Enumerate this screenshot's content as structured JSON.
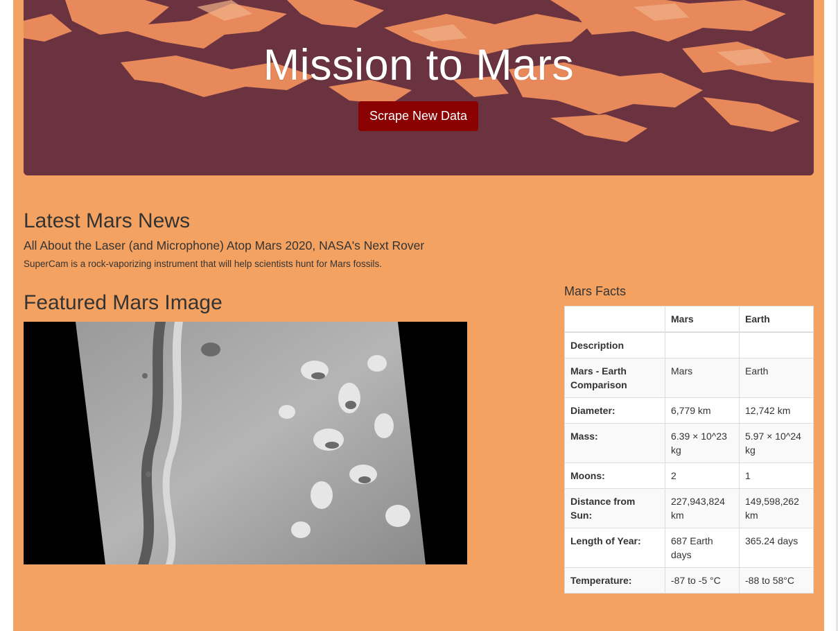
{
  "header": {
    "title": "Mission to Mars",
    "scrape_button": "Scrape New Data"
  },
  "news": {
    "heading": "Latest Mars News",
    "title": "All About the Laser (and Microphone) Atop Mars 2020, NASA's Next Rover",
    "paragraph": "SuperCam is a rock-vaporizing instrument that will help scientists hunt for Mars fossils."
  },
  "featured": {
    "heading": "Featured Mars Image"
  },
  "facts": {
    "heading": "Mars Facts",
    "columns": [
      "",
      "Mars",
      "Earth"
    ],
    "rows": [
      {
        "label": "Description",
        "mars": "",
        "earth": ""
      },
      {
        "label": "Mars - Earth Comparison",
        "mars": "Mars",
        "earth": "Earth"
      },
      {
        "label": "Diameter:",
        "mars": "6,779 km",
        "earth": "12,742 km"
      },
      {
        "label": "Mass:",
        "mars": "6.39 × 10^23 kg",
        "earth": "5.97 × 10^24 kg"
      },
      {
        "label": "Moons:",
        "mars": "2",
        "earth": "1"
      },
      {
        "label": "Distance from Sun:",
        "mars": "227,943,824 km",
        "earth": "149,598,262 km"
      },
      {
        "label": "Length of Year:",
        "mars": "687 Earth days",
        "earth": "365.24 days"
      },
      {
        "label": "Temperature:",
        "mars": "-87 to -5 °C",
        "earth": "-88 to 58°C"
      }
    ]
  },
  "colors": {
    "page_bg": "#f4a261",
    "banner_bg": "#6b3340",
    "banner_terrain": "#e8895c",
    "button_bg": "#8b0000"
  }
}
